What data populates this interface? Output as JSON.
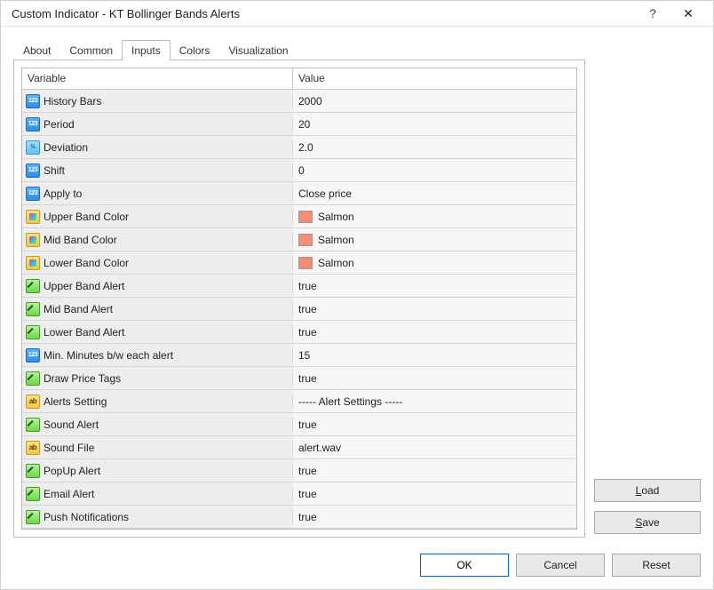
{
  "window": {
    "title": "Custom Indicator - KT Bollinger Bands Alerts",
    "help": "?",
    "close": "✕"
  },
  "tabs": [
    "About",
    "Common",
    "Inputs",
    "Colors",
    "Visualization"
  ],
  "activeTab": 2,
  "columns": {
    "variable": "Variable",
    "value": "Value"
  },
  "rows": [
    {
      "icon": "int",
      "name": "History Bars",
      "value": "2000"
    },
    {
      "icon": "int",
      "name": "Period",
      "value": "20"
    },
    {
      "icon": "real",
      "name": "Deviation",
      "value": "2.0"
    },
    {
      "icon": "int",
      "name": "Shift",
      "value": "0"
    },
    {
      "icon": "int",
      "name": "Apply to",
      "value": "Close price"
    },
    {
      "icon": "color",
      "name": "Upper Band Color",
      "value": "Salmon",
      "swatch": "#f98c72"
    },
    {
      "icon": "color",
      "name": "Mid Band Color",
      "value": "Salmon",
      "swatch": "#f98c72"
    },
    {
      "icon": "color",
      "name": "Lower Band Color",
      "value": "Salmon",
      "swatch": "#f98c72"
    },
    {
      "icon": "bool",
      "name": "Upper Band Alert",
      "value": "true"
    },
    {
      "icon": "bool",
      "name": "Mid Band Alert",
      "value": "true"
    },
    {
      "icon": "bool",
      "name": "Lower Band Alert",
      "value": "true"
    },
    {
      "icon": "int",
      "name": "Min. Minutes b/w each alert",
      "value": "15"
    },
    {
      "icon": "bool",
      "name": "Draw Price Tags",
      "value": "true"
    },
    {
      "icon": "str",
      "name": "Alerts Setting",
      "value": "----- Alert Settings -----"
    },
    {
      "icon": "bool",
      "name": "Sound Alert",
      "value": "true"
    },
    {
      "icon": "str",
      "name": "Sound File",
      "value": "alert.wav"
    },
    {
      "icon": "bool",
      "name": "PopUp Alert",
      "value": "true"
    },
    {
      "icon": "bool",
      "name": "Email Alert",
      "value": "true"
    },
    {
      "icon": "bool",
      "name": "Push Notifications",
      "value": "true"
    }
  ],
  "buttons": {
    "load": "Load",
    "save": "Save",
    "ok": "OK",
    "cancel": "Cancel",
    "reset": "Reset"
  }
}
